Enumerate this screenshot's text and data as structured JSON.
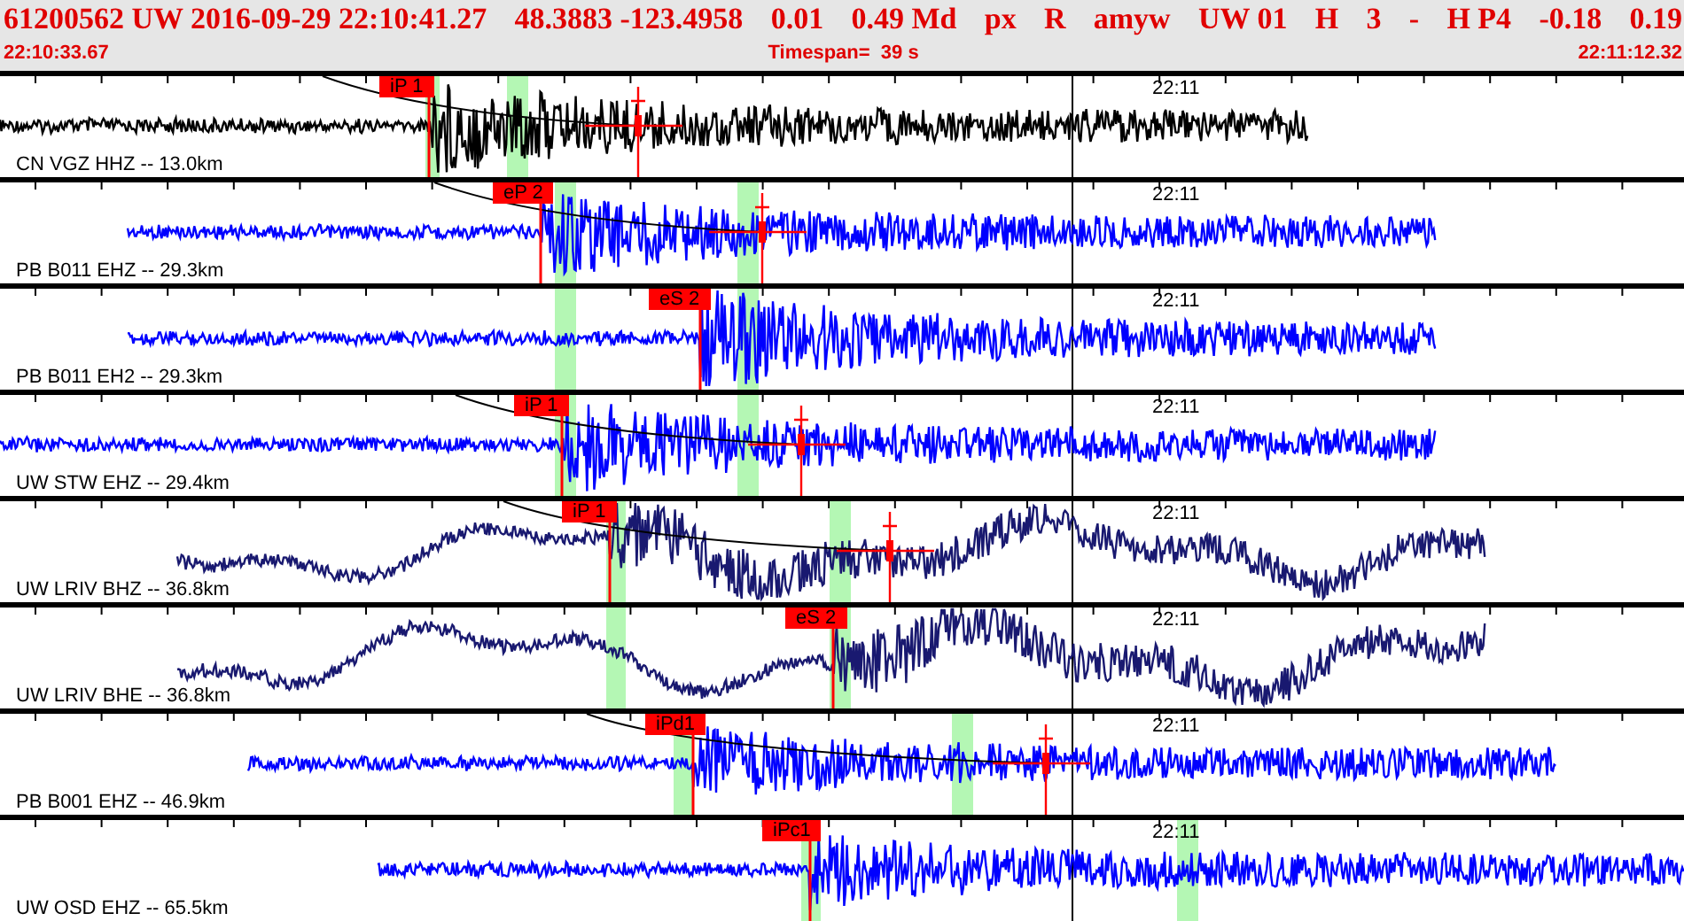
{
  "header": {
    "summary": [
      "61200562 UW 2016-09-29 22:10:41.27",
      "48.3883 -123.4958",
      "0.01",
      "0.49 Md",
      "px",
      "R",
      "amyw",
      "UW 01",
      "H",
      "3",
      "-",
      "H P4",
      "-0.18",
      "0.19"
    ],
    "start_time": "22:10:33.67",
    "timespan": "Timespan=  39 s",
    "end_time": "22:11:12.32"
  },
  "traces": [
    {
      "station": "CN VGZ HHZ -- 13.0km",
      "time_label": "22:11",
      "color": "#000000",
      "picks": [
        {
          "label": "iP 1"
        }
      ]
    },
    {
      "station": "PB B011 EHZ -- 29.3km",
      "time_label": "22:11",
      "color": "#0000ff",
      "picks": [
        {
          "label": "eP 2"
        }
      ]
    },
    {
      "station": "PB B011 EH2 -- 29.3km",
      "time_label": "22:11",
      "color": "#0000ff",
      "picks": [
        {
          "label": "eS 2"
        }
      ]
    },
    {
      "station": "UW STW EHZ -- 29.4km",
      "time_label": "22:11",
      "color": "#0000ff",
      "picks": [
        {
          "label": "iP 1"
        }
      ]
    },
    {
      "station": "UW LRIV BHZ -- 36.8km",
      "time_label": "22:11",
      "color": "#191970",
      "picks": [
        {
          "label": "iP 1"
        }
      ]
    },
    {
      "station": "UW LRIV BHE -- 36.8km",
      "time_label": "22:11",
      "color": "#191970",
      "picks": [
        {
          "label": "eS 2"
        }
      ]
    },
    {
      "station": "PB B001 EHZ -- 46.9km",
      "time_label": "22:11",
      "color": "#0000ff",
      "picks": [
        {
          "label": "iPd1"
        }
      ]
    },
    {
      "station": "UW OSD EHZ -- 65.5km",
      "time_label": "22:11",
      "color": "#0000ff",
      "picks": [
        {
          "label": "iPc1"
        }
      ]
    }
  ]
}
